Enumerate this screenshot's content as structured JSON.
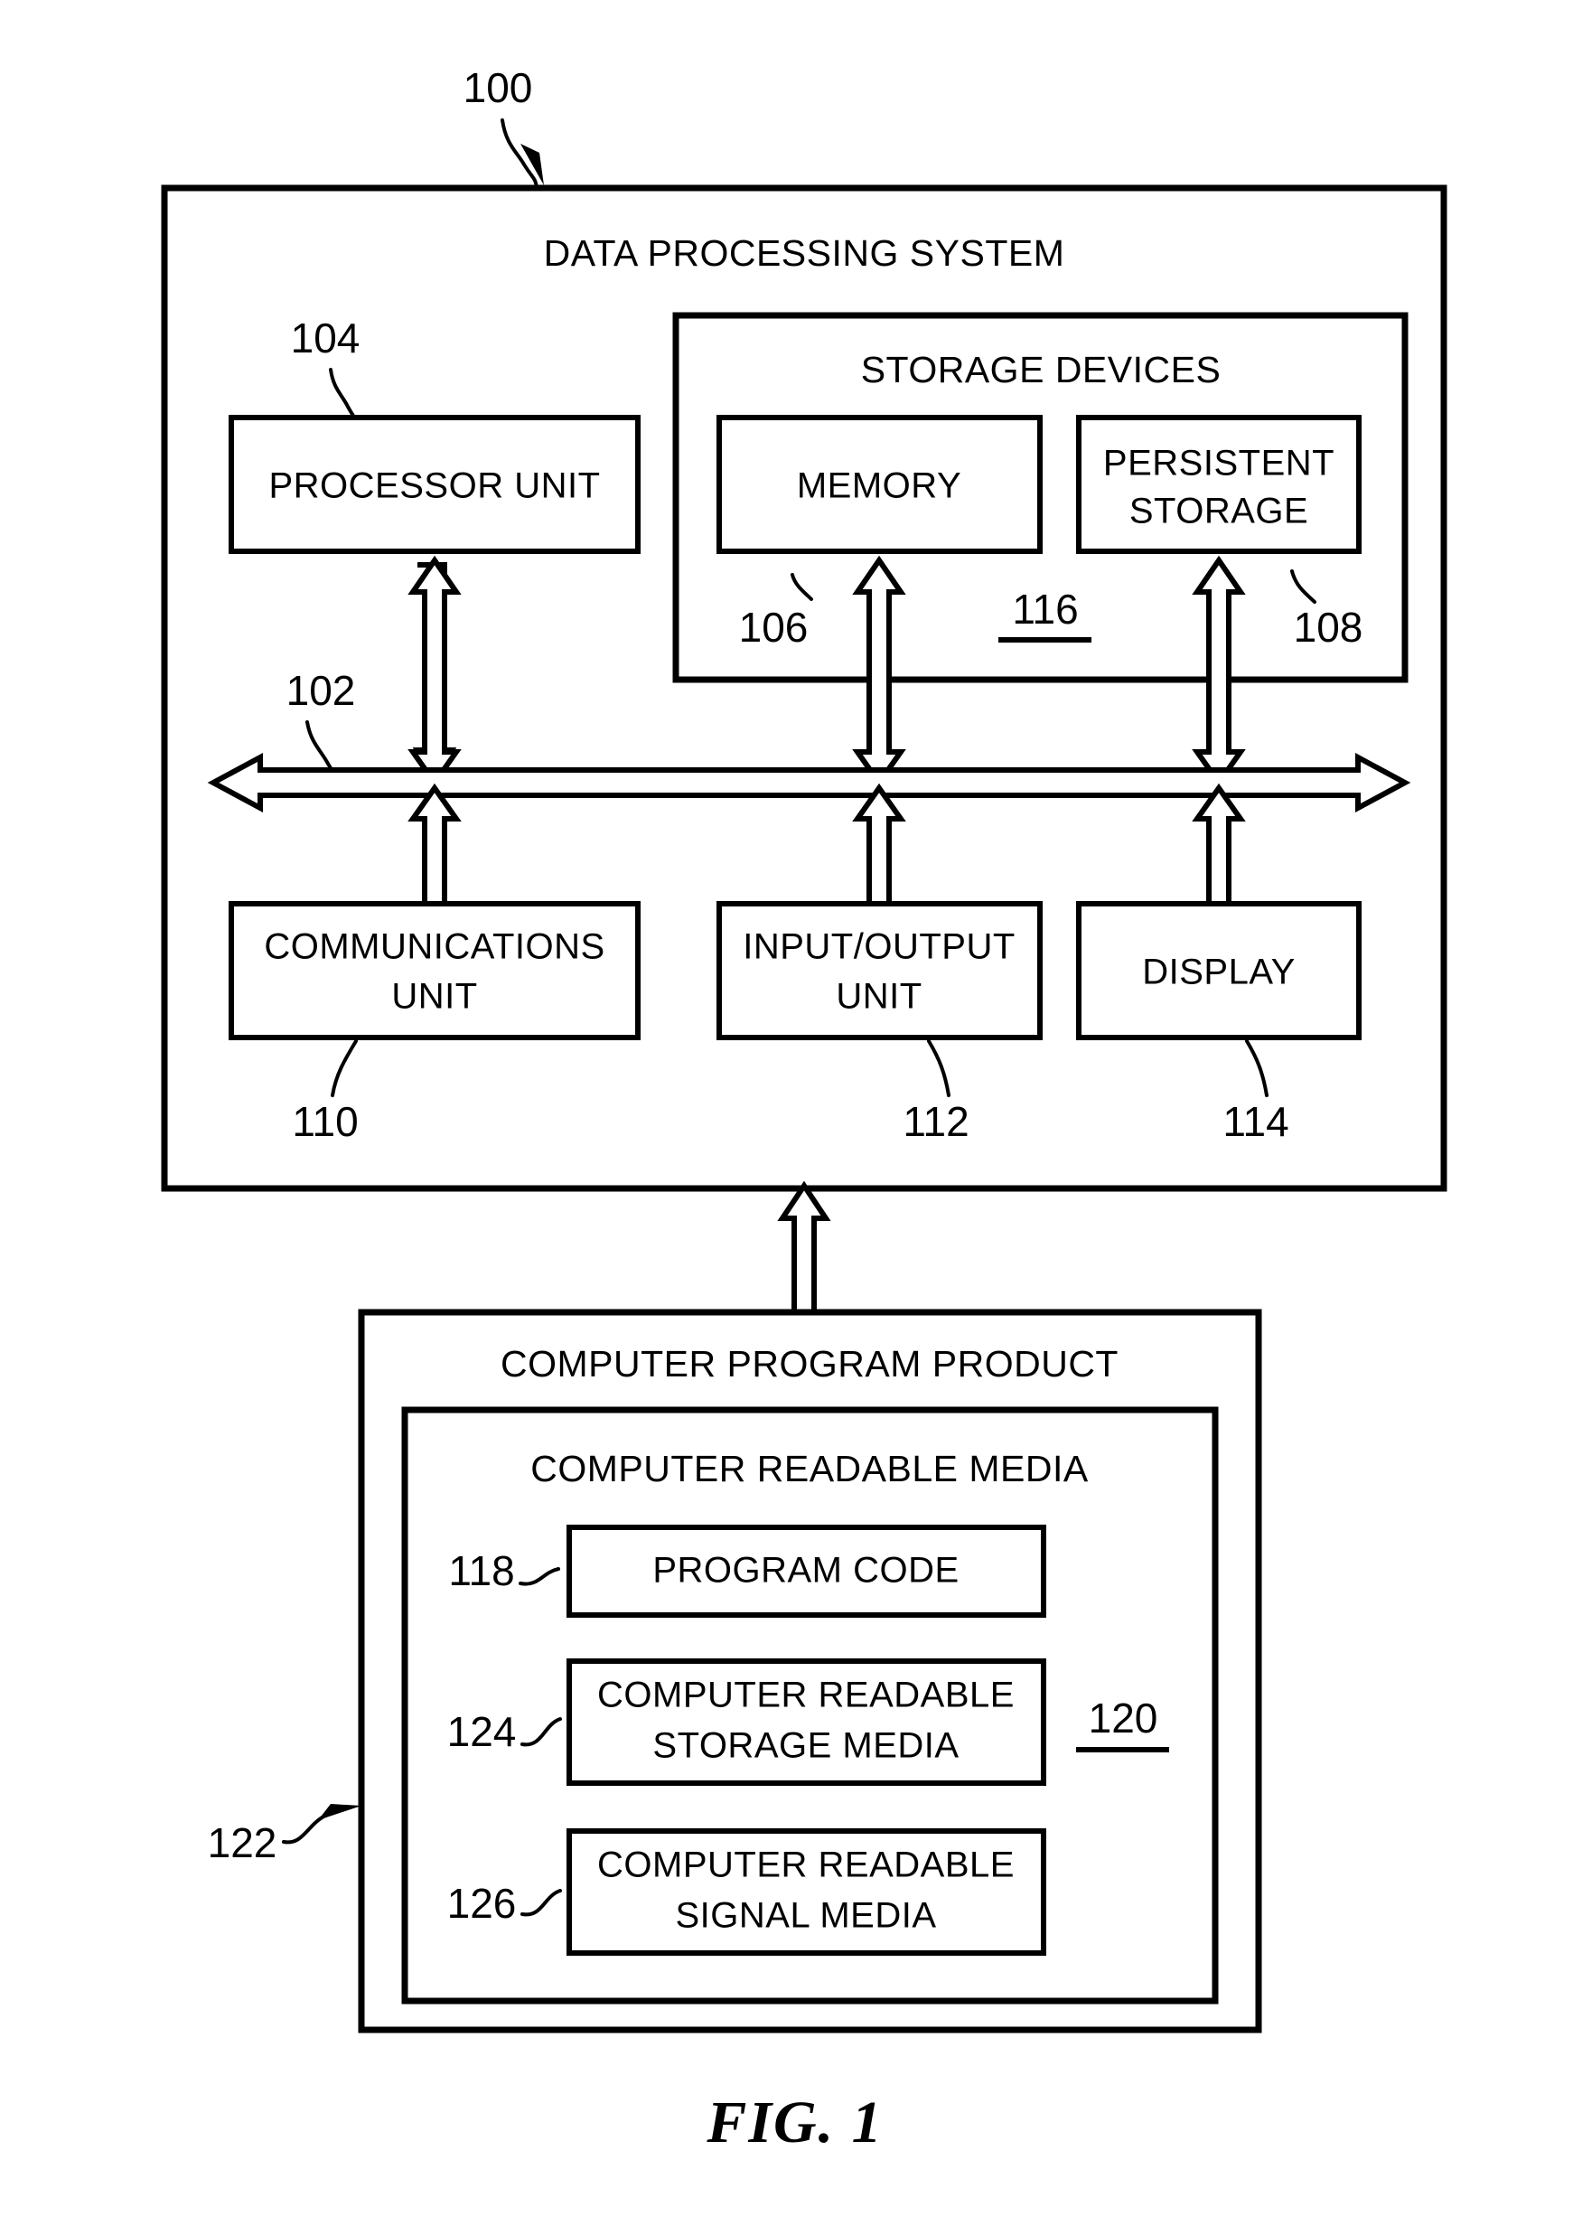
{
  "figure": {
    "caption": "FIG. 1",
    "system_ref": "100"
  },
  "system": {
    "title": "DATA PROCESSING SYSTEM",
    "ref": "100",
    "bus": {
      "ref": "102",
      "name": "system-bus"
    },
    "top_row": [
      {
        "label": "PROCESSOR UNIT",
        "ref": "104",
        "name": "processor-unit"
      }
    ],
    "storage_devices": {
      "title": "STORAGE DEVICES",
      "ref": "116",
      "ref_underlined": true,
      "items": [
        {
          "label": "MEMORY",
          "ref": "106",
          "name": "memory"
        },
        {
          "label_line1": "PERSISTENT",
          "label_line2": "STORAGE",
          "ref": "108",
          "name": "persistent-storage"
        }
      ]
    },
    "bottom_row": [
      {
        "label_line1": "COMMUNICATIONS",
        "label_line2": "UNIT",
        "ref": "110",
        "name": "communications-unit"
      },
      {
        "label_line1": "INPUT/OUTPUT",
        "label_line2": "UNIT",
        "ref": "112",
        "name": "input-output-unit"
      },
      {
        "label_line1": "DISPLAY",
        "label_line2": "",
        "ref": "114",
        "name": "display"
      }
    ]
  },
  "computer_program_product": {
    "title": "COMPUTER PROGRAM PRODUCT",
    "ref": "122",
    "media": {
      "title": "COMPUTER READABLE MEDIA",
      "ref": "120",
      "ref_underlined": true,
      "items": [
        {
          "label_line1": "PROGRAM CODE",
          "label_line2": "",
          "ref": "118",
          "name": "program-code"
        },
        {
          "label_line1": "COMPUTER READABLE",
          "label_line2": "STORAGE MEDIA",
          "ref": "124",
          "name": "computer-readable-storage-media"
        },
        {
          "label_line1": "COMPUTER READABLE",
          "label_line2": "SIGNAL MEDIA",
          "ref": "126",
          "name": "computer-readable-signal-media"
        }
      ]
    }
  },
  "colors": {
    "line": "#000000",
    "background": "#ffffff"
  }
}
